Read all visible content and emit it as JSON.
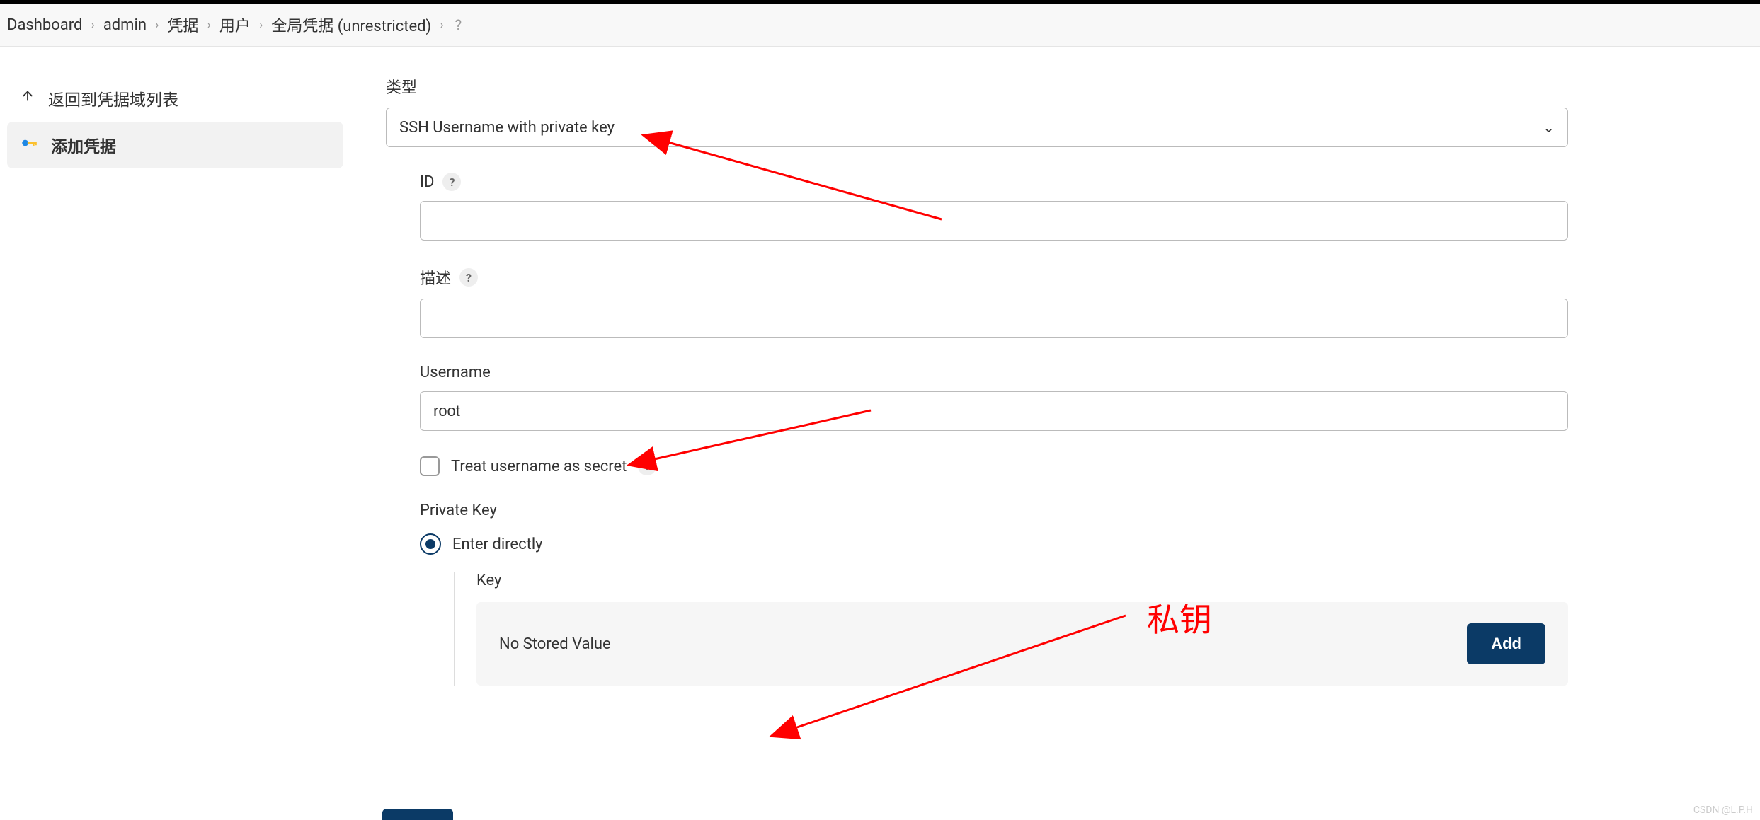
{
  "breadcrumb": {
    "items": [
      "Dashboard",
      "admin",
      "凭据",
      "用户",
      "全局凭据 (unrestricted)"
    ]
  },
  "sidebar": {
    "back_label": "返回到凭据域列表",
    "add_label": "添加凭据"
  },
  "form": {
    "type_label": "类型",
    "type_value": "SSH Username with private key",
    "id_label": "ID",
    "id_value": "",
    "desc_label": "描述",
    "desc_value": "",
    "username_label": "Username",
    "username_value": "root",
    "treat_secret_label": "Treat username as secret",
    "private_key_label": "Private Key",
    "enter_directly_label": "Enter directly",
    "key_label": "Key",
    "no_stored_value": "No Stored Value",
    "add_button": "Add"
  },
  "annotation": {
    "private_key_label": "私钥"
  },
  "watermark": "CSDN @L.P.H"
}
